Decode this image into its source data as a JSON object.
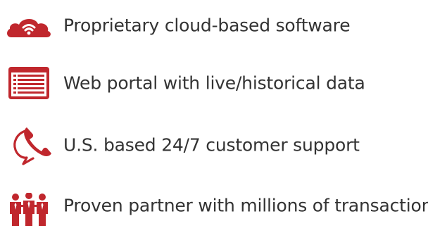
{
  "accent_color": "#c0272d",
  "text_color": "#333333",
  "features": [
    {
      "icon": "cloud-wifi-icon",
      "label": "Proprietary cloud-based software"
    },
    {
      "icon": "web-portal-list-icon",
      "label": "Web portal with live/historical data"
    },
    {
      "icon": "phone-support-icon",
      "label": "U.S. based 24/7 customer support"
    },
    {
      "icon": "people-partner-icon",
      "label": "Proven partner with millions of transactions"
    }
  ]
}
